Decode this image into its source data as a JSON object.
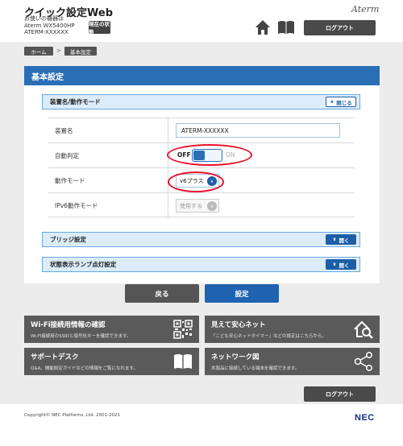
{
  "header": {
    "app_title": "クイック設定Web",
    "device_line1": "お使いの機器は",
    "device_line2": "Aterm WX5400HP",
    "device_line3": "ATERM-XXXXXX",
    "status_button": "現在の状態",
    "brand": "Aterm",
    "logout_label": "ログアウト"
  },
  "breadcrumb": {
    "home": "ホーム",
    "separator": ">",
    "current": "基本設定"
  },
  "page": {
    "title": "基本設定"
  },
  "sections": {
    "device_mode": {
      "title": "装置名/動作モード",
      "toggle_label": "閉じる"
    },
    "bridge": {
      "title": "ブリッジ設定",
      "toggle_label": "開く"
    },
    "led": {
      "title": "状態表示ランプ点灯設定",
      "toggle_label": "開く"
    }
  },
  "settings": {
    "device_name": {
      "label": "装置名",
      "value": "ATERM-XXXXXX"
    },
    "auto_detect": {
      "label": "自動判定",
      "off_label": "OFF",
      "on_label": "ON",
      "state": "off"
    },
    "operation_mode": {
      "label": "動作モード",
      "selected": "v6プラス"
    },
    "ipv6_mode": {
      "label": "IPv6動作モード",
      "selected": "使用する"
    }
  },
  "actions": {
    "back_label": "戻る",
    "apply_label": "設定"
  },
  "tiles": [
    {
      "title": "Wi-Fi接続用情報の確認",
      "desc": "Wi-Fi接続用のSSIDと暗号化キーを確認できます。",
      "icon": "qr-code-icon"
    },
    {
      "title": "見えて安心ネット",
      "desc": "「こども安心ネットタイマー」などの設定はこちらから。",
      "icon": "house-magnifier-icon"
    },
    {
      "title": "サポートデスク",
      "desc": "Q&A、機能設定ガイドなどの情報をご覧になれます。",
      "icon": "book-icon"
    },
    {
      "title": "ネットワーク図",
      "desc": "本製品に接続している端末を確認できます。",
      "icon": "network-share-icon"
    }
  ],
  "footer": {
    "logout_label": "ログアウト",
    "copyright": "Copyright© NEC Platforms, Ltd. 2001-2021",
    "company_logo": "NEC"
  },
  "colors": {
    "accent": "#2a6fb6",
    "section_bg": "#dcecfa",
    "highlight": "#e8102a",
    "dark_button": "#4a4a4a"
  }
}
